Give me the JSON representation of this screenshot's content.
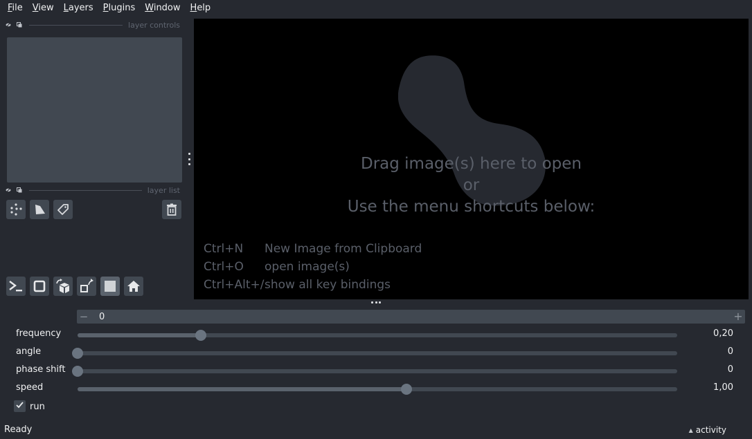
{
  "menubar": {
    "items": [
      {
        "label": "File",
        "mnemonic": "F",
        "rest": "ile"
      },
      {
        "label": "View",
        "mnemonic": "V",
        "rest": "iew"
      },
      {
        "label": "Layers",
        "mnemonic": "L",
        "rest": "ayers"
      },
      {
        "label": "Plugins",
        "mnemonic": "P",
        "rest": "lugins"
      },
      {
        "label": "Window",
        "mnemonic": "W",
        "rest": "indow"
      },
      {
        "label": "Help",
        "mnemonic": "H",
        "rest": "elp"
      }
    ]
  },
  "layer_controls": {
    "title": "layer controls"
  },
  "layer_list": {
    "title": "layer list",
    "buttons": [
      {
        "icon": "new-points-icon"
      },
      {
        "icon": "new-shapes-icon"
      },
      {
        "icon": "new-labels-icon"
      },
      {
        "icon": "delete-layer-icon"
      }
    ]
  },
  "viewer_buttons": [
    {
      "icon": "console-icon"
    },
    {
      "icon": "ndisplay-square-icon"
    },
    {
      "icon": "roll-dims-icon"
    },
    {
      "icon": "transpose-icon"
    },
    {
      "icon": "grid-toggle-icon"
    },
    {
      "icon": "home-icon"
    }
  ],
  "viewer": {
    "welcome_line1": "Drag image(s) here to open",
    "welcome_line2": "or",
    "welcome_line3": "Use the menu shortcuts below:",
    "shortcuts": [
      {
        "key": "Ctrl+N",
        "action": "New Image from Clipboard"
      },
      {
        "key": "Ctrl+O",
        "action": "open image(s)"
      },
      {
        "key": "Ctrl+Alt+/",
        "action": "show all key bindings"
      }
    ],
    "logo_color": "#262930"
  },
  "dims": {
    "minus": "−",
    "value": "0",
    "plus": "+"
  },
  "params": [
    {
      "label": "frequency",
      "value": "0,20",
      "fraction": 0.205
    },
    {
      "label": "angle",
      "value": "0",
      "fraction": 0.0
    },
    {
      "label": "phase shift",
      "value": "0",
      "fraction": 0.0
    },
    {
      "label": "speed",
      "value": "1,00",
      "fraction": 0.548
    }
  ],
  "run": {
    "label": "run",
    "checked": true
  },
  "status": {
    "text": "Ready",
    "activity": "activity"
  },
  "colors": {
    "background": "#262930",
    "panel": "#414851",
    "canvas": "#000000",
    "text": "#f0f1f2"
  }
}
